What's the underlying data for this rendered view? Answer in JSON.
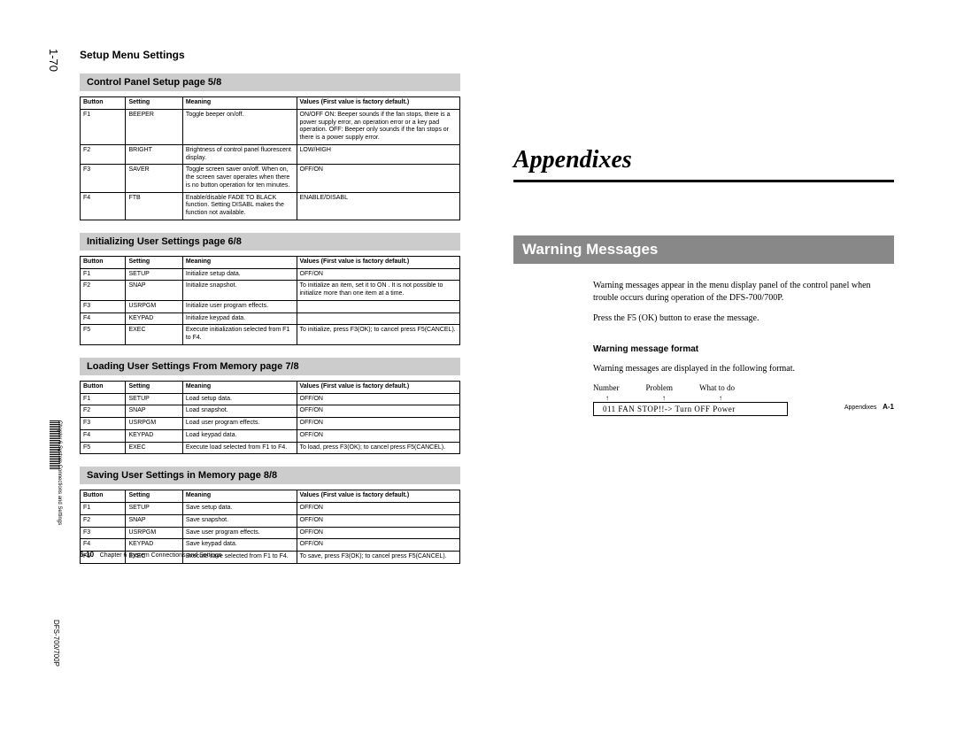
{
  "margin": {
    "page_num_top": "1-70",
    "chapter_side": "Chapter 6   System Connections and Settings",
    "model_side": "DFS-700/700P"
  },
  "left": {
    "heading": "Setup Menu Settings",
    "sections": [
      {
        "title": "Control Panel Setup page 5/8",
        "headers": [
          "Button",
          "Setting",
          "Meaning",
          "Values (First value is factory default.)"
        ],
        "rows": [
          [
            "F1",
            "BEEPER",
            "Toggle beeper on/off.",
            "ON/OFF\nON: Beeper sounds if the fan stops, there is a power supply error, an operation error or a key pad operation.\nOFF: Beeper only sounds if the fan stops or there is a power supply error."
          ],
          [
            "F2",
            "BRIGHT",
            "Brightness of control panel fluorescent display.",
            "LOW/HIGH"
          ],
          [
            "F3",
            "SAVER",
            "Toggle screen saver on/off. When on, the screen saver operates when there is no button operation for ten minutes.",
            "OFF/ON"
          ],
          [
            "F4",
            "FTB",
            "Enable/disable FADE TO BLACK function.\nSetting DISABL makes the function not available.",
            "ENABLE/DISABL"
          ]
        ]
      },
      {
        "title": "Initializing User Settings page 6/8",
        "headers": [
          "Button",
          "Setting",
          "Meaning",
          "Values (First value is factory default.)"
        ],
        "rows": [
          [
            "F1",
            "SETUP",
            "Initialize setup data.",
            "OFF/ON"
          ],
          [
            "F2",
            "SNAP",
            "Initialize snapshot.",
            "To initialize an item, set it to  ON . It is not possible to initialize more than one item at a time."
          ],
          [
            "F3",
            "USRPGM",
            "Initialize user program effects.",
            ""
          ],
          [
            "F4",
            "KEYPAD",
            "Initialize keypad data.",
            ""
          ],
          [
            "F5",
            "EXEC",
            "Execute initialization selected from F1 to F4.",
            "To initialize, press F3(OK); to cancel press F5(CANCEL)."
          ]
        ]
      },
      {
        "title": "Loading User Settings From Memory page 7/8",
        "headers": [
          "Button",
          "Setting",
          "Meaning",
          "Values (First value is factory default.)"
        ],
        "rows": [
          [
            "F1",
            "SETUP",
            "Load setup data.",
            "OFF/ON"
          ],
          [
            "F2",
            "SNAP",
            "Load snapshot.",
            "OFF/ON"
          ],
          [
            "F3",
            "USRPGM",
            "Load user program effects.",
            "OFF/ON"
          ],
          [
            "F4",
            "KEYPAD",
            "Load keypad data.",
            "OFF/ON"
          ],
          [
            "F5",
            "EXEC",
            "Execute load selected from F1 to F4.",
            "To load, press F3(OK); to cancel press F5(CANCEL)."
          ]
        ]
      },
      {
        "title": "Saving User Settings in Memory page 8/8",
        "headers": [
          "Button",
          "Setting",
          "Meaning",
          "Values (First value is factory default.)"
        ],
        "rows": [
          [
            "F1",
            "SETUP",
            "Save setup data.",
            "OFF/ON"
          ],
          [
            "F2",
            "SNAP",
            "Save snapshot.",
            "OFF/ON"
          ],
          [
            "F3",
            "USRPGM",
            "Save user program effects.",
            "OFF/ON"
          ],
          [
            "F4",
            "KEYPAD",
            "Save keypad data.",
            "OFF/ON"
          ],
          [
            "F5",
            "EXEC",
            "Execute save selected from F1 to F4.",
            "To save, press F3(OK); to cancel press F5(CANCEL)."
          ]
        ]
      }
    ],
    "footer_num": "6-10",
    "footer_txt": "Chapter 6   System Connections and Settings"
  },
  "right": {
    "app_title": "Appendixes",
    "wm_title": "Warning Messages",
    "para1": "Warning messages appear in the menu display panel of the control panel when trouble occurs during operation of the DFS-700/700P.",
    "para2": "Press the F5 (OK) button to erase the message.",
    "sub": "Warning message format",
    "para3": "Warning messages are displayed in the following format.",
    "fmt_labels": [
      "Number",
      "Problem",
      "What to do"
    ],
    "fmt_tick": "↑",
    "fmt_example": "011       FAN STOP!!->       Turn OFF Power",
    "footer_txt": "Appendixes",
    "footer_num": "A-1"
  }
}
